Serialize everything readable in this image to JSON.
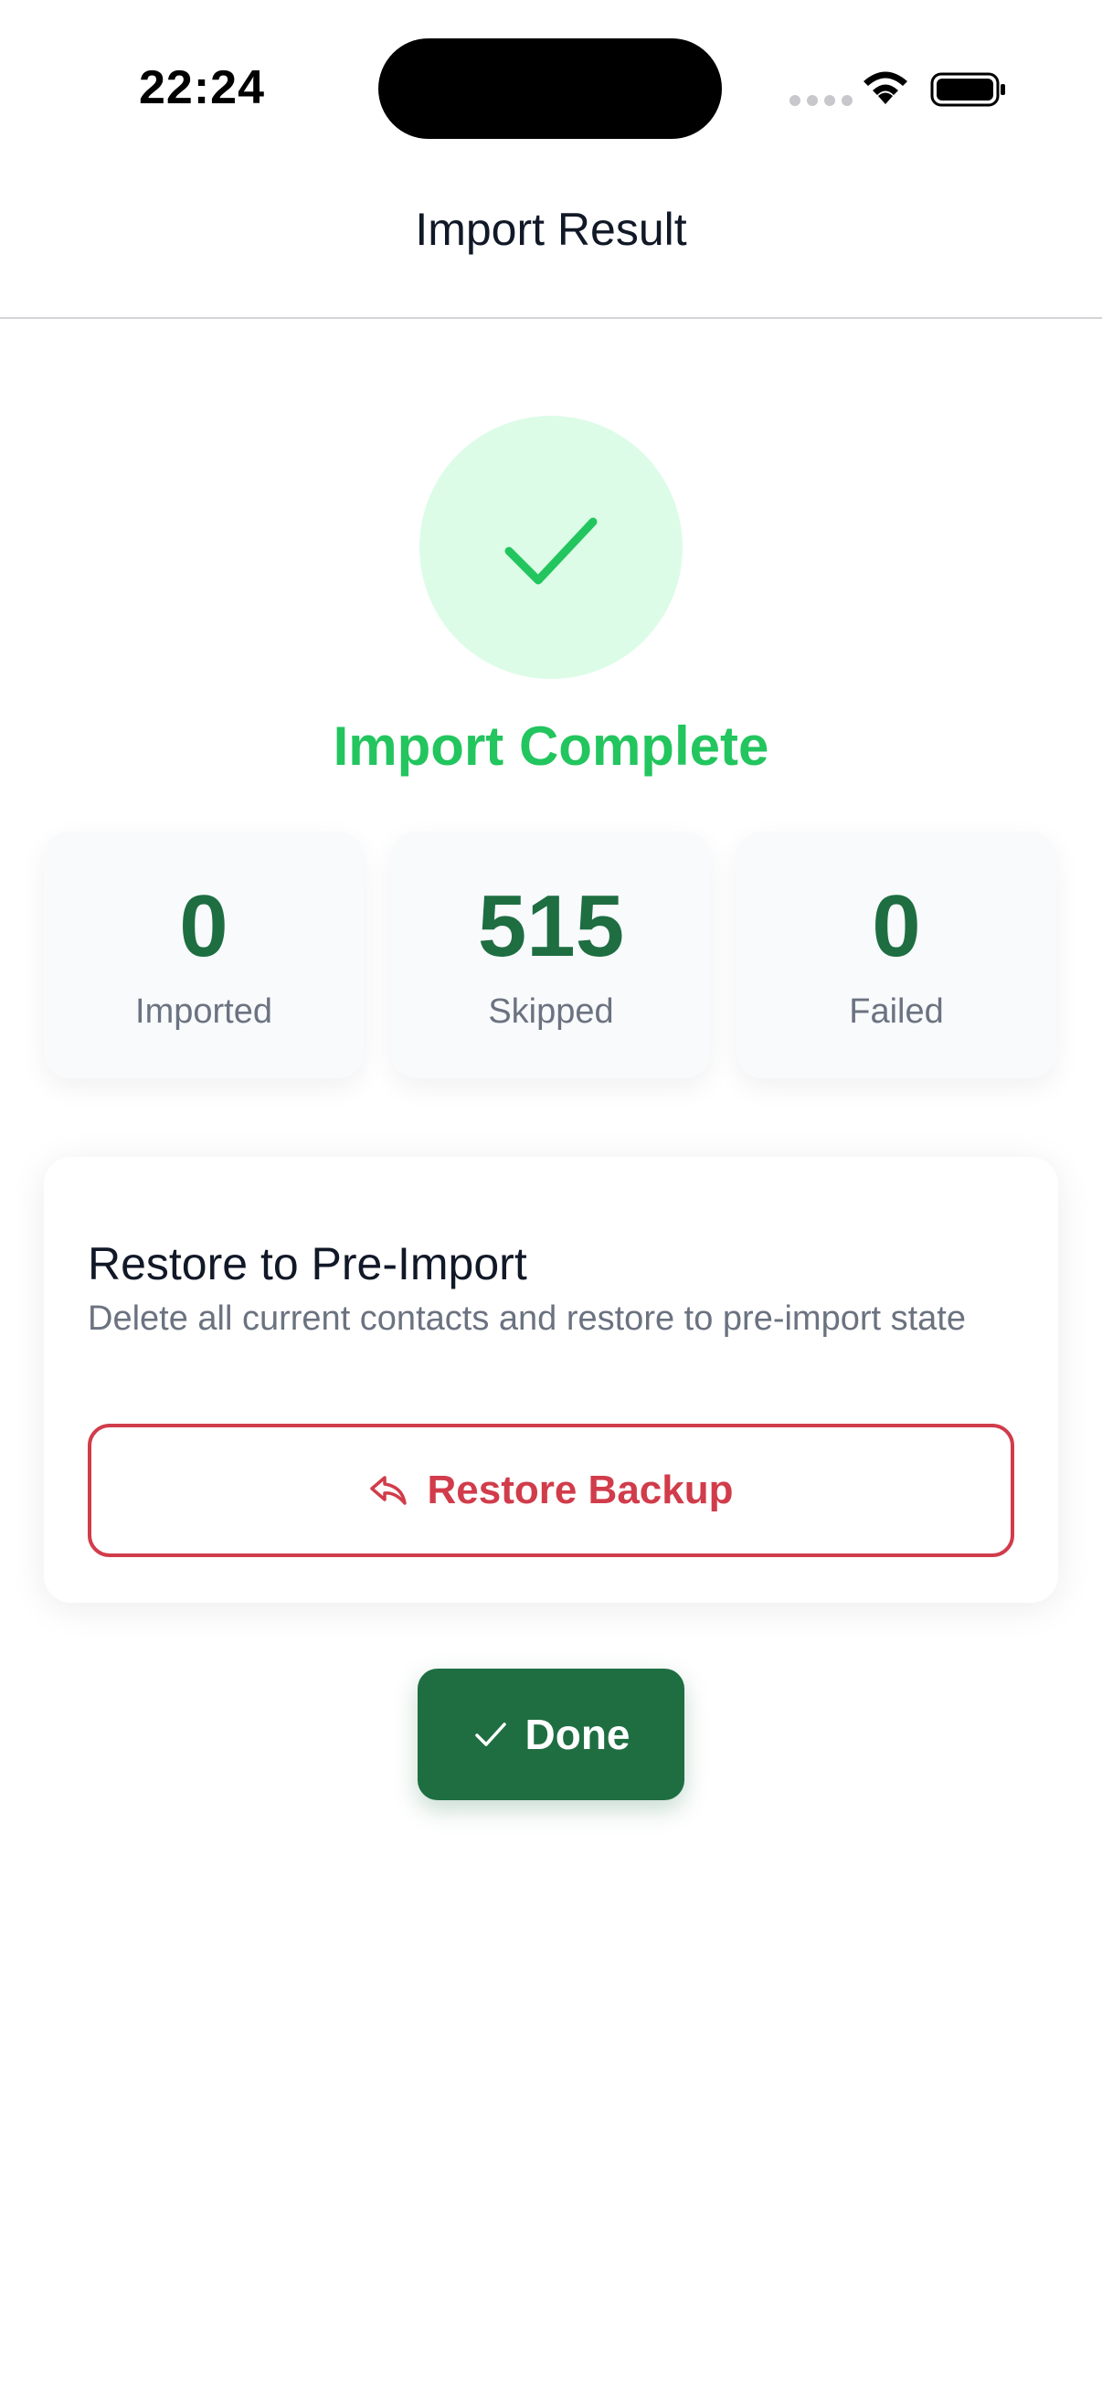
{
  "status_bar": {
    "time": "22:24",
    "icons": [
      "cellular-signal-icon",
      "wifi-icon",
      "battery-icon"
    ]
  },
  "nav": {
    "title": "Import Result"
  },
  "result": {
    "icon": "checkmark-icon",
    "title": "Import Complete",
    "accent_color": "#22c55e"
  },
  "stats": [
    {
      "value": "0",
      "label": "Imported"
    },
    {
      "value": "515",
      "label": "Skipped"
    },
    {
      "value": "0",
      "label": "Failed"
    }
  ],
  "restore": {
    "title": "Restore to Pre-Import",
    "description": "Delete all current contacts and restore to pre-import state",
    "button_icon": "reply-arrow-icon",
    "button_label": "Restore Backup",
    "danger_color": "#d13c4b"
  },
  "done": {
    "icon": "checkmark-icon",
    "label": "Done",
    "brand_color": "#1e6e42"
  }
}
